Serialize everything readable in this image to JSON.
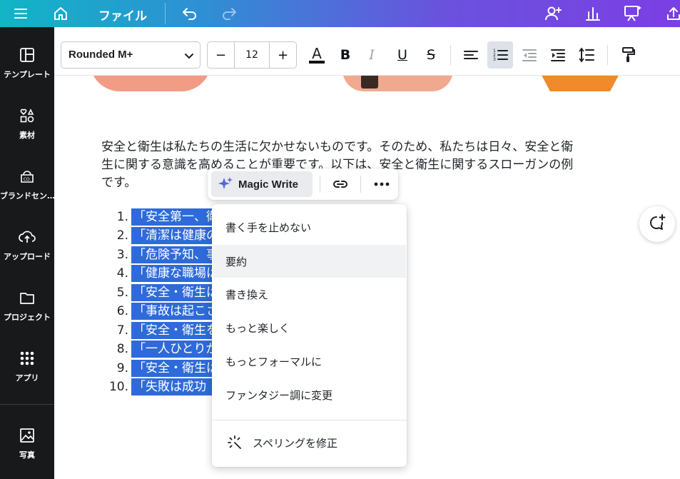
{
  "header": {
    "menu_icon": "hamburger-icon",
    "home_icon": "home-icon",
    "file_label": "ファイル",
    "undo_icon": "undo-icon",
    "redo_icon": "redo-icon",
    "right_icons": [
      "share-people-icon",
      "insights-chart-icon",
      "present-icon",
      "upload-export-icon"
    ]
  },
  "sidebar": {
    "items": [
      {
        "label": "テンプレート",
        "icon": "layout-icon"
      },
      {
        "label": "素材",
        "icon": "elements-icon"
      },
      {
        "label": "ブランドセン…",
        "icon": "brand-icon"
      },
      {
        "label": "アップロード",
        "icon": "cloud-upload-icon"
      },
      {
        "label": "プロジェクト",
        "icon": "folder-icon"
      },
      {
        "label": "アプリ",
        "icon": "apps-grid-icon"
      },
      {
        "label": "写真",
        "icon": "photo-icon"
      }
    ]
  },
  "toolbar": {
    "font_family": "Rounded M+",
    "font_size": "12",
    "minus": "−",
    "plus": "+",
    "color_letter": "A",
    "bold": "B",
    "italic": "I",
    "underline": "U",
    "strike": "S"
  },
  "canvas": {
    "paragraph": "安全と衛生は私たちの生活に欠かせないものです。そのため、私たちは日々、安全と衛\n生に関する意識を高めることが重要です。以下は、安全と衛生に関するスローガンの例\nです。",
    "list": [
      {
        "num": "1.",
        "text": "「安全第一、衛"
      },
      {
        "num": "2.",
        "text": "「清潔は健康の                          」"
      },
      {
        "num": "3.",
        "text": "「危険予知、事"
      },
      {
        "num": "4.",
        "text": "「健康な職場は"
      },
      {
        "num": "5.",
        "text": "「安全・衛生は"
      },
      {
        "num": "6.",
        "text": "「事故は起こさ"
      },
      {
        "num": "7.",
        "text": "「安全・衛生を                          」"
      },
      {
        "num": "8.",
        "text": "「一人ひとりが                          識しよう！」"
      },
      {
        "num": "9.",
        "text": "「安全・衛生は                         境」"
      },
      {
        "num": "10.",
        "text": "「失敗は成功                             されない」"
      }
    ]
  },
  "magic_pill": {
    "label": "Magic Write"
  },
  "dropdown": {
    "items": [
      "書く手を止めない",
      "要約",
      "書き換え",
      "もっと楽しく",
      "もっとフォーマルに",
      "ファンタジー調に変更"
    ],
    "footer": "スペリングを修正"
  }
}
